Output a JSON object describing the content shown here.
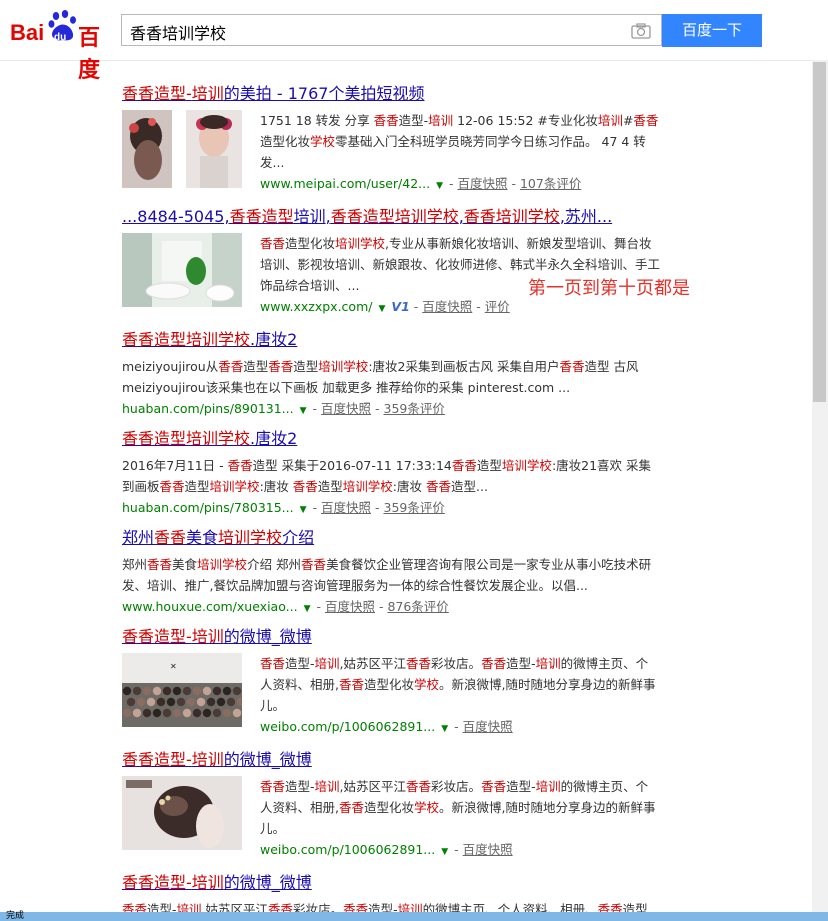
{
  "search": {
    "query": "香香培训学校",
    "button": "百度一下"
  },
  "logo": {
    "text_left": "Bai",
    "text_paw": "du",
    "text_right": "百度"
  },
  "annotation": "第一页到第十页都是",
  "results": [
    {
      "title": [
        [
          "香香造型-",
          "h"
        ],
        [
          "培训",
          "h"
        ],
        [
          "的美拍 - 1767个美拍短视频",
          ""
        ]
      ],
      "abs": [
        [
          "1751 18 转发 分享 ",
          ""
        ],
        [
          "香香",
          "h"
        ],
        [
          "造型-",
          ""
        ],
        [
          "培训",
          "h"
        ],
        [
          " 12-06 15:52 #专业化妆",
          ""
        ],
        [
          "培训",
          "h"
        ],
        [
          "#",
          ""
        ],
        [
          "香香",
          "h"
        ],
        [
          "造型化妆",
          ""
        ],
        [
          "学校",
          "h"
        ],
        [
          "零基础入门全科班学员晓芳同学今日练习作品。 47 4 转发...",
          ""
        ]
      ],
      "url": "www.meipai.com/user/42...",
      "snapshot": "百度快照",
      "reviews": "107条评价"
    },
    {
      "title": [
        [
          "...8484-5045,",
          ""
        ],
        [
          "香香造型",
          "h"
        ],
        [
          "培训",
          ""
        ],
        [
          ",",
          ""
        ],
        [
          "香香造型培训学校",
          "h"
        ],
        [
          ",",
          ""
        ],
        [
          "香香培训学校",
          "h"
        ],
        [
          ",苏州...",
          ""
        ]
      ],
      "abs": [
        [
          "香香",
          "h"
        ],
        [
          "造型化妆",
          ""
        ],
        [
          "培训学校",
          "h"
        ],
        [
          ",专业从事新娘化妆培训、新娘发型培训、舞台妆培训、影视妆培训、新娘跟妆、化妆师进修、韩式半永久全科培训、手工饰品综合培训、...",
          ""
        ]
      ],
      "url": "www.xxzxpx.com/",
      "badge": "V1",
      "snapshot": "百度快照",
      "reviews": "评价"
    },
    {
      "title": [
        [
          "香香造型",
          "h"
        ],
        [
          "培训学校",
          "h"
        ],
        [
          ".唐妆2",
          ""
        ]
      ],
      "abs": [
        [
          "meiziyoujirou从",
          ""
        ],
        [
          "香香",
          "h"
        ],
        [
          "造型",
          ""
        ],
        [
          "香香",
          "h"
        ],
        [
          "造型",
          ""
        ],
        [
          "培训学校",
          "h"
        ],
        [
          ":唐妆2采集到画板古风 采集自用户",
          ""
        ],
        [
          "香香",
          "h"
        ],
        [
          "造型 古风 meiziyoujirou该采集也在以下画板 加载更多 推荐给你的采集 pinterest.com ...",
          ""
        ]
      ],
      "url": "huaban.com/pins/890131...",
      "snapshot": "百度快照",
      "reviews": "359条评价"
    },
    {
      "title": [
        [
          "香香造型",
          "h"
        ],
        [
          "培训学校",
          "h"
        ],
        [
          ".唐妆2",
          ""
        ]
      ],
      "abs": [
        [
          "2016年7月11日 - ",
          ""
        ],
        [
          "香香",
          "h"
        ],
        [
          "造型 采集于2016-07-11 17:33:14",
          ""
        ],
        [
          "香香",
          "h"
        ],
        [
          "造型",
          ""
        ],
        [
          "培训学校",
          "h"
        ],
        [
          ":唐妆21喜欢 采集到画板",
          ""
        ],
        [
          "香香",
          "h"
        ],
        [
          "造型",
          ""
        ],
        [
          "培训学校",
          "h"
        ],
        [
          ":唐妆 ",
          ""
        ],
        [
          "香香",
          "h"
        ],
        [
          "造型",
          ""
        ],
        [
          "培训学校",
          "h"
        ],
        [
          ":唐妆 ",
          ""
        ],
        [
          "香香",
          "h"
        ],
        [
          "造型...",
          ""
        ]
      ],
      "url": "huaban.com/pins/780315...",
      "snapshot": "百度快照",
      "reviews": "359条评价"
    },
    {
      "title": [
        [
          "郑州",
          ""
        ],
        [
          "香香",
          "h"
        ],
        [
          "美食",
          ""
        ],
        [
          "培训学校",
          "h"
        ],
        [
          "介绍",
          ""
        ]
      ],
      "abs": [
        [
          "郑州",
          ""
        ],
        [
          "香香",
          "h"
        ],
        [
          "美食",
          ""
        ],
        [
          "培训学校",
          "h"
        ],
        [
          "介绍 郑州",
          ""
        ],
        [
          "香香",
          "h"
        ],
        [
          "美食餐饮企业管理咨询有限公司是一家专业从事小吃技术研发、培训、推广,餐饮品牌加盟与咨询管理服务为一体的综合性餐饮发展企业。以倡...",
          ""
        ]
      ],
      "url": "www.houxue.com/xuexiao...",
      "snapshot": "百度快照",
      "reviews": "876条评价"
    },
    {
      "title": [
        [
          "香香造型-",
          "h"
        ],
        [
          "培训",
          "h"
        ],
        [
          "的微博_微博",
          ""
        ]
      ],
      "abs": [
        [
          "香香",
          "h"
        ],
        [
          "造型-",
          ""
        ],
        [
          "培训",
          "h"
        ],
        [
          ",姑苏区平江",
          ""
        ],
        [
          "香香",
          "h"
        ],
        [
          "彩妆店。",
          ""
        ],
        [
          "香香",
          "h"
        ],
        [
          "造型-",
          ""
        ],
        [
          "培训",
          "h"
        ],
        [
          "的微博主页、个人资料、相册,",
          ""
        ],
        [
          "香香",
          "h"
        ],
        [
          "造型化妆",
          ""
        ],
        [
          "学校",
          "h"
        ],
        [
          "。新浪微博,随时随地分享身边的新鲜事儿。",
          ""
        ]
      ],
      "url": "weibo.com/p/1006062891...",
      "snapshot": "百度快照"
    },
    {
      "title": [
        [
          "香香造型-",
          "h"
        ],
        [
          "培训",
          "h"
        ],
        [
          "的微博_微博",
          ""
        ]
      ],
      "abs": [
        [
          "香香",
          "h"
        ],
        [
          "造型-",
          ""
        ],
        [
          "培训",
          "h"
        ],
        [
          ",姑苏区平江",
          ""
        ],
        [
          "香香",
          "h"
        ],
        [
          "彩妆店。",
          ""
        ],
        [
          "香香",
          "h"
        ],
        [
          "造型-",
          ""
        ],
        [
          "培训",
          "h"
        ],
        [
          "的微博主页、个人资料、相册,",
          ""
        ],
        [
          "香香",
          "h"
        ],
        [
          "造型化妆",
          ""
        ],
        [
          "学校",
          "h"
        ],
        [
          "。新浪微博,随时随地分享身边的新鲜事儿。",
          ""
        ]
      ],
      "url": "weibo.com/p/1006062891...",
      "snapshot": "百度快照"
    },
    {
      "title": [
        [
          "香香造型-",
          "h"
        ],
        [
          "培训",
          "h"
        ],
        [
          "的微博_微博",
          ""
        ]
      ],
      "abs": [
        [
          "香香",
          "h"
        ],
        [
          "造型-",
          ""
        ],
        [
          "培训",
          "h"
        ],
        [
          ",姑苏区平江",
          ""
        ],
        [
          "香香",
          "h"
        ],
        [
          "彩妆店。",
          ""
        ],
        [
          "香香",
          "h"
        ],
        [
          "造型-",
          ""
        ],
        [
          "培训",
          "h"
        ],
        [
          "的微博主页、个人资料、相册、",
          ""
        ],
        [
          "香香",
          "h"
        ],
        [
          "造型",
          ""
        ]
      ]
    }
  ],
  "status": "完成"
}
